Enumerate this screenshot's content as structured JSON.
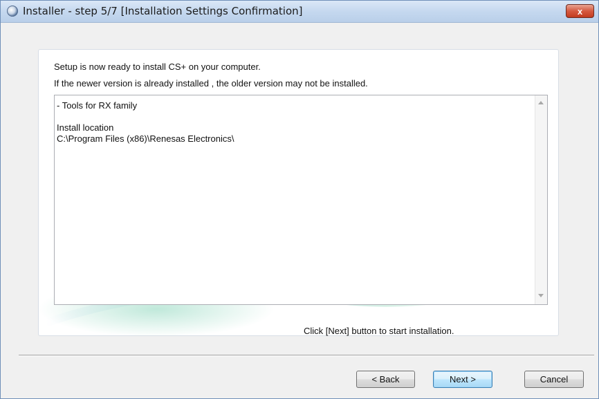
{
  "window": {
    "title": "Installer - step 5/7 [Installation Settings Confirmation]",
    "close_label": "x"
  },
  "main": {
    "message_line1": "Setup is now ready to install CS+ on your computer.",
    "message_line2": "If the newer version is already installed , the older version may not be installed.",
    "summary_lines": [
      "- Tools for RX family",
      "",
      "Install location",
      "C:\\Program Files (x86)\\Renesas Electronics\\"
    ],
    "hint": "Click [Next] button to start installation."
  },
  "buttons": {
    "back": "< Back",
    "next": "Next >",
    "cancel": "Cancel"
  },
  "colors": {
    "close_button": "#c23b1f",
    "default_button_border": "#3c7fb1"
  },
  "icons": {
    "app": "installer-globe-icon",
    "scroll_up": "arrow-up-icon",
    "scroll_down": "arrow-down-icon"
  }
}
